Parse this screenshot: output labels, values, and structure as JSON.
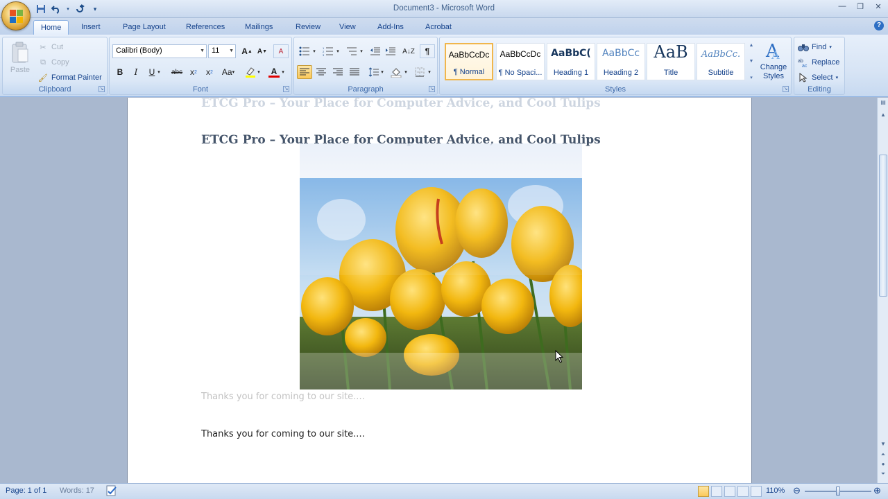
{
  "window": {
    "title": "Document3 - Microsoft Word"
  },
  "quick_access": {
    "icons": [
      "save-icon",
      "undo-icon",
      "redo-icon",
      "customize-icon"
    ]
  },
  "tabs": [
    "Home",
    "Insert",
    "Page Layout",
    "References",
    "Mailings",
    "Review",
    "View",
    "Add-Ins",
    "Acrobat"
  ],
  "ribbon": {
    "clipboard": {
      "label": "Clipboard",
      "paste": "Paste",
      "cut": "Cut",
      "copy": "Copy",
      "format_painter": "Format Painter"
    },
    "font": {
      "label": "Font",
      "family": "Calibri (Body)",
      "size": "11"
    },
    "paragraph": {
      "label": "Paragraph"
    },
    "styles": {
      "label": "Styles",
      "items": [
        {
          "sample": "AaBbCcDc",
          "name": "¶ Normal"
        },
        {
          "sample": "AaBbCcDc",
          "name": "¶ No Spaci..."
        },
        {
          "sample": "AaBbC(",
          "name": "Heading 1"
        },
        {
          "sample": "AaBbCc",
          "name": "Heading 2"
        },
        {
          "sample": "AaB",
          "name": "Title"
        },
        {
          "sample": "AaBbCc.",
          "name": "Subtitle"
        }
      ],
      "change_styles": "Change Styles"
    },
    "editing": {
      "label": "Editing",
      "find": "Find",
      "replace": "Replace",
      "select": "Select"
    }
  },
  "document": {
    "heading_ghost": "ETCG Pro – Your Place for Computer Advice, and Cool Tulips",
    "heading": "ETCG Pro – Your Place for Computer Advice, and Cool Tulips",
    "body_ghost": "Thanks you for coming to our site....",
    "body": "Thanks you for coming to our site...."
  },
  "status": {
    "page": "Page: 1 of 1",
    "words": "Words: 17",
    "zoom": "110%"
  }
}
